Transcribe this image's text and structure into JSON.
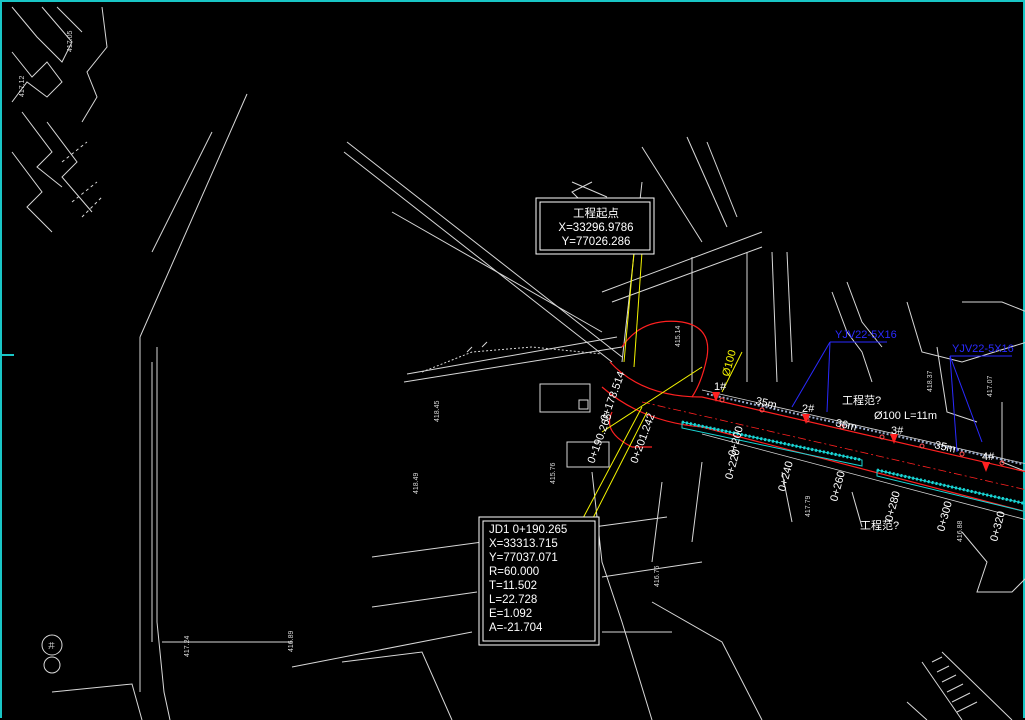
{
  "colors": {
    "background": "#000000",
    "frame": "#19c6c6",
    "linework": "#d8d8d8",
    "road_red": "#ff2020",
    "leader_yellow": "#f4f400",
    "hatch_cyan": "#19d6d6",
    "blue_text": "#2a2aff"
  },
  "start_callout": {
    "title": "工程起点",
    "x": "X=33296.9786",
    "y": "Y=77026.286"
  },
  "jd_callout": {
    "jd": "JD1  0+190.265",
    "x": "X=33313.715",
    "y": "Y=77037.071",
    "r": "R=60.000",
    "t": "T=11.502",
    "l": "L=22.728",
    "e": "E=1.092",
    "a": "A=-21.704"
  },
  "stations": [
    "0+200",
    "0+220",
    "0+240",
    "0+260",
    "0+280",
    "0+300",
    "0+320"
  ],
  "manholes": [
    "1#",
    "2#",
    "3#",
    "4#"
  ],
  "spacings": [
    "35m",
    "36m",
    "35m"
  ],
  "pipe_label": "Ø100 L=11m",
  "boundary_labels": [
    "工程范?",
    "工程范?"
  ],
  "blue_labels": [
    "YJV22-5X16",
    "YJV22-5X16"
  ],
  "yellow_label": "Ø100",
  "curve_labels": [
    "0+178.514",
    "0+190.265",
    "0+201.242"
  ],
  "elevations": [
    "415.14",
    "418.45",
    "418.49",
    "417.24",
    "416.89",
    "415.76",
    "417.79",
    "416.76",
    "418.37",
    "417.07",
    "416.88"
  ],
  "circle_label": "井"
}
